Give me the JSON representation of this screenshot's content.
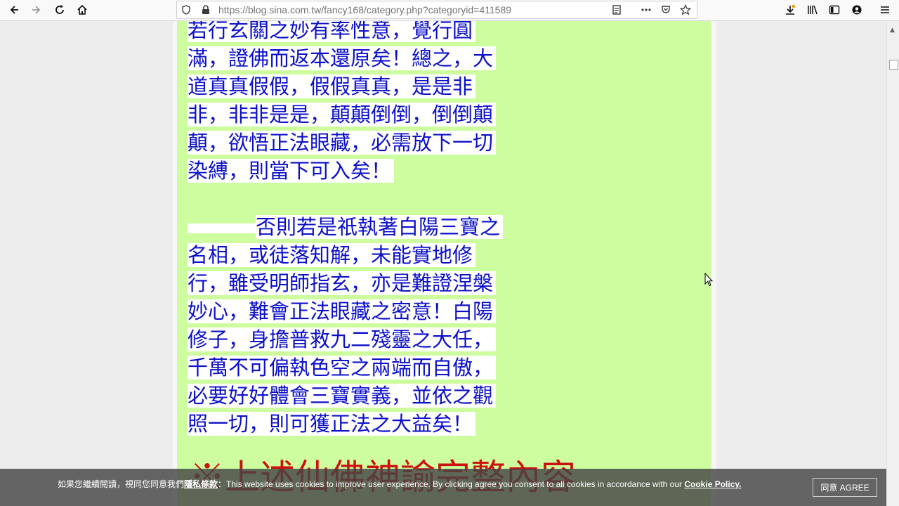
{
  "browser": {
    "url": "https://blog.sina.com.tw/fancy168/category.php?categoryid=411589"
  },
  "article": {
    "lines_block1": [
      "若行玄關之妙有率性意，覺行圓",
      "滿，證佛而返本還原矣！總之，大",
      "道真真假假，假假真真，是是非",
      "非，非非是是，顛顛倒倒，倒倒顛",
      "顛，欲悟正法眼藏，必需放下一切",
      "染縛，則當下可入矣！"
    ],
    "lines_block2_first": "否則若是祇執著白陽三寶之",
    "lines_block2": [
      "名相，或徒落知解，未能實地修",
      "行，雖受明師指玄，亦是難證涅槃",
      "妙心，難會正法眼藏之密意！白陽",
      "修子，身擔普救九二殘靈之大任，",
      "千萬不可偏執色空之兩端而自傲，",
      "必要好好體會三寶實義，並依之觀",
      "照一切，則可獲正法之大益矣！"
    ],
    "red_heading": "※上述仙佛神諭完整內容"
  },
  "cookie_bar": {
    "text_zh_prefix": "如果您繼續閱讀，視同您同意我們",
    "privacy_link": "隱私條款",
    "text_en": "：This website uses cookies to improve user experience. By clicking agree you consent to all cookies in accordance with our ",
    "policy_link": "Cookie Policy.",
    "agree_label": "同意 AGREE"
  },
  "colors": {
    "article_text": "#0c10c9",
    "content_bg": "#cdfd9e",
    "heading_red": "#cc1010"
  },
  "icons": {
    "back": "back-arrow-icon",
    "forward": "forward-arrow-icon",
    "reload": "reload-icon",
    "home": "home-icon",
    "shield": "tracking-shield-icon",
    "lock": "lock-icon",
    "reader": "reader-view-icon",
    "more": "page-actions-icon",
    "pocket": "pocket-icon",
    "bookmark": "bookmark-star-icon",
    "downloads": "downloads-icon",
    "library": "library-icon",
    "sidebar": "sidebar-icon",
    "account": "account-icon",
    "menu": "hamburger-menu-icon"
  }
}
